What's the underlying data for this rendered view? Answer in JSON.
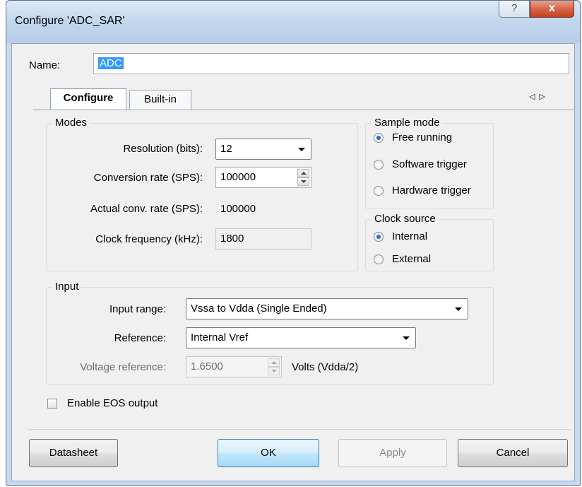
{
  "window": {
    "title": "Configure 'ADC_SAR'",
    "help_glyph": "?",
    "close_glyph": "x"
  },
  "name_row": {
    "label": "Name:",
    "value": "ADC"
  },
  "tabs": [
    {
      "label": "Configure",
      "active": true
    },
    {
      "label": "Built-in",
      "active": false
    }
  ],
  "tab_nav": {
    "left": "◁",
    "right": "▷"
  },
  "modes": {
    "title": "Modes",
    "resolution": {
      "label": "Resolution (bits):",
      "value": "12"
    },
    "conversion_rate": {
      "label": "Conversion rate (SPS):",
      "value": "100000"
    },
    "actual_rate": {
      "label": "Actual conv. rate (SPS):",
      "value": "100000"
    },
    "clock_freq": {
      "label": "Clock frequency (kHz):",
      "value": "1800"
    }
  },
  "sample_mode": {
    "title": "Sample mode",
    "options": [
      {
        "label": "Free running",
        "selected": true
      },
      {
        "label": "Software trigger",
        "selected": false
      },
      {
        "label": "Hardware trigger",
        "selected": false
      }
    ]
  },
  "clock_source": {
    "title": "Clock source",
    "options": [
      {
        "label": "Internal",
        "selected": true
      },
      {
        "label": "External",
        "selected": false
      }
    ]
  },
  "input": {
    "title": "Input",
    "input_range": {
      "label": "Input range:",
      "value": "Vssa to Vdda (Single Ended)"
    },
    "reference": {
      "label": "Reference:",
      "value": "Internal Vref"
    },
    "voltage_reference": {
      "label": "Voltage reference:",
      "value": "1.6500",
      "unit": "Volts (Vdda/2)"
    }
  },
  "eos": {
    "label": "Enable EOS output",
    "checked": false
  },
  "buttons": {
    "datasheet": "Datasheet",
    "ok": "OK",
    "apply": "Apply",
    "cancel": "Cancel"
  }
}
